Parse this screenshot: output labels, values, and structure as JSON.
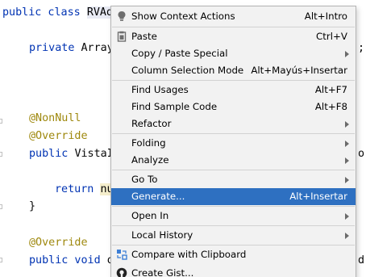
{
  "editor": {
    "lines": {
      "l1": {
        "kw": "public class ",
        "cls": "RVAd"
      },
      "l2": {
        "kw": "private ",
        "plain": "Array"
      },
      "l3": {
        "ann": "@NonNull"
      },
      "l4": {
        "ann": "@Override"
      },
      "l5": {
        "kw": "public ",
        "plain": "VistaI"
      },
      "l6": {
        "kw": "return ",
        "hl": "nu"
      },
      "l7": {
        "plain": "}"
      },
      "l8": {
        "ann": "@Override"
      },
      "l9": {
        "kw": "public void ",
        "plain": "o"
      }
    },
    "right_fragments": {
      "r1": ";",
      "r2": "o",
      "r3": "d"
    }
  },
  "context_menu": {
    "items": {
      "show_context_actions": {
        "label": "Show Context Actions",
        "shortcut": "Alt+Intro",
        "icon": "bulb-icon"
      },
      "paste": {
        "label": "Paste",
        "shortcut": "Ctrl+V",
        "icon": "clipboard-icon"
      },
      "copy_paste_special": {
        "label": "Copy / Paste Special"
      },
      "column_selection_mode": {
        "label": "Column Selection Mode",
        "shortcut": "Alt+Mayús+Insertar"
      },
      "find_usages": {
        "label": "Find Usages",
        "shortcut": "Alt+F7"
      },
      "find_sample_code": {
        "label": "Find Sample Code",
        "shortcut": "Alt+F8"
      },
      "refactor": {
        "label": "Refactor"
      },
      "folding": {
        "label": "Folding"
      },
      "analyze": {
        "label": "Analyze"
      },
      "go_to": {
        "label": "Go To"
      },
      "generate": {
        "label": "Generate...",
        "shortcut": "Alt+Insertar"
      },
      "open_in": {
        "label": "Open In"
      },
      "local_history": {
        "label": "Local History"
      },
      "compare_with_clipboard": {
        "label": "Compare with Clipboard",
        "icon": "compare-icon"
      },
      "create_gist": {
        "label": "Create Gist...",
        "icon": "github-icon"
      }
    },
    "selected_item": "generate",
    "colors": {
      "selected_bg": "#2e70c1",
      "menu_bg": "#f2f2f2"
    }
  }
}
